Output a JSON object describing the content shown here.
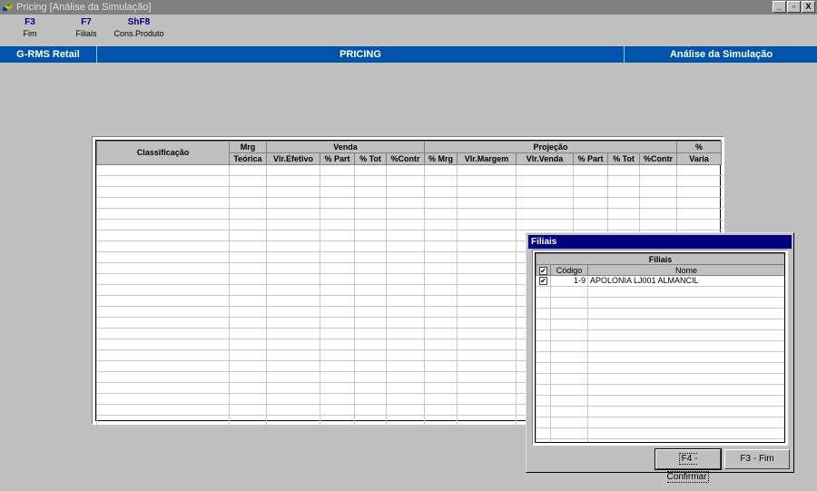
{
  "window": {
    "title": "Pricing [Análise da Simulação]"
  },
  "window_buttons": [
    "_",
    "▫",
    "X"
  ],
  "fkeys": [
    {
      "key": "F3",
      "label": "Fim"
    },
    {
      "key": "F7",
      "label": "Filiais"
    },
    {
      "key": "ShF8",
      "label": "Cons.Produto"
    }
  ],
  "header": {
    "left": "G-RMS Retail",
    "center": "PRICING",
    "right": "Análise da Simulação"
  },
  "grid": {
    "group_headers": {
      "classificacao": "Classificação",
      "mrg": "Mrg",
      "venda": "Venda",
      "projecao": "Projeção",
      "pct": "%"
    },
    "sub_headers": {
      "mrg": "Teórica",
      "pct": "Varia"
    },
    "venda_columns": [
      "Vlr.Efetivo",
      "% Part",
      "% Tot",
      "%Contr"
    ],
    "projecao_columns": [
      "% Mrg",
      "Vlr.Margem",
      "Vlr.Venda",
      "% Part",
      "% Tot",
      "%Contr"
    ]
  },
  "dialog": {
    "title": "Filiais",
    "list_header": "Filiais",
    "columns": {
      "check": "✔",
      "codigo": "Código",
      "nome": "Nome"
    },
    "rows": [
      {
        "checked": "✔",
        "codigo": "1-9",
        "nome": "APOLONIA LJ001 ALMANCIL"
      }
    ],
    "confirm_label": "F4 - Confirmar",
    "fim_label": "F3 - Fim"
  }
}
